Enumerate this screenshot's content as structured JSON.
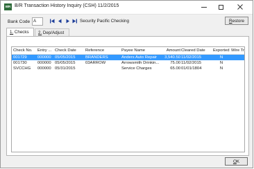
{
  "window": {
    "title": "B/R Transaction History Inquiry (CSH) 11/2/2015",
    "app_icon_text": "B/R"
  },
  "header": {
    "bank_code_label": "Bank Code",
    "bank_code_value": "A",
    "bank_name": "Security Pacific Checking",
    "restore_label": "Restore",
    "restore_mnemonic": "R",
    "restore_rest": "estore"
  },
  "tabs": [
    {
      "number": "1.",
      "label": "Checks",
      "active": true
    },
    {
      "number": "2.",
      "label": "Dep/Adjust",
      "active": false
    }
  ],
  "grid": {
    "columns": [
      "Check No.",
      "Entry ...",
      "Check Date",
      "Reference",
      "Payee Name",
      "Amount",
      "Cleared Date",
      "Exported",
      "Wire Tran"
    ],
    "rows": [
      {
        "check_no": "001729",
        "entry": "000000",
        "check_date": "05/05/2015",
        "reference": "BRANDERS",
        "payee": "Anders Auto Repair",
        "amount": "3,540.50",
        "cleared": "11/02/2015",
        "exported": "N",
        "wire": "",
        "selected": true
      },
      {
        "check_no": "001730",
        "entry": "000000",
        "check_date": "05/05/2015",
        "reference": "03ARROW",
        "payee": "Arrowsmith Drinkin...",
        "amount": "75.00",
        "cleared": "11/02/2015",
        "exported": "N",
        "wire": "",
        "selected": false
      },
      {
        "check_no": "SVCCHG",
        "entry": "000000",
        "check_date": "05/31/2015",
        "reference": "",
        "payee": "Service Charges",
        "amount": "65.00",
        "cleared": "01/01/1804",
        "exported": "N",
        "wire": "",
        "selected": false
      }
    ]
  },
  "footer": {
    "ok_label": "OK",
    "ok_mnemonic": "O",
    "ok_rest": "K"
  },
  "colors": {
    "selection": "#3399ff",
    "app_icon": "#2e6b3a",
    "nav_arrow": "#1f3f9a"
  }
}
